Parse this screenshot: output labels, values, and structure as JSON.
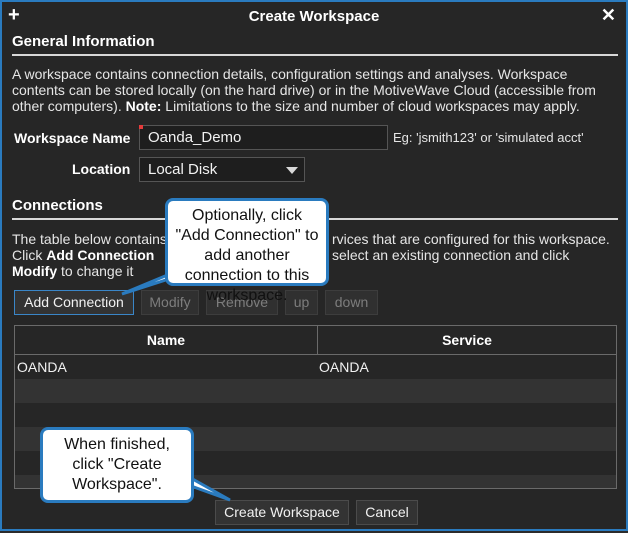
{
  "window": {
    "title": "Create Workspace",
    "add_icon": "+",
    "close_icon": "✕"
  },
  "general": {
    "section_title": "General Information",
    "description_before_note": "A workspace contains connection details, configuration settings and analyses. Workspace contents can be stored locally (on the hard drive) or in the MotiveWave Cloud (accessible from other computers).",
    "note_label": "Note:",
    "description_after_note": " Limitations to the size and number of cloud workspaces may apply."
  },
  "workspace_name": {
    "label": "Workspace Name",
    "value": "Oanda_Demo",
    "hint": "Eg: 'jsmith123' or 'simulated acct'"
  },
  "location": {
    "label": "Location",
    "selected": "Local Disk"
  },
  "connections": {
    "section_title": "Connections",
    "desc_line1_a": "The table below contains",
    "desc_line1_b": "rvices that are configured for this workspace.",
    "desc_line2_a": "Click",
    "desc_line2_bold": "Add Connection",
    "desc_line2_b": "select an existing connection and click",
    "desc_line3_bold": "Modify",
    "desc_line3_a": "to change it",
    "buttons": {
      "add": "Add Connection",
      "modify": "Modify",
      "remove": "Remove",
      "up": "up",
      "down": "down"
    },
    "columns": [
      "Name",
      "Service"
    ],
    "rows": [
      {
        "name": "OANDA",
        "service": "OANDA"
      }
    ]
  },
  "callouts": {
    "add_connection": "Optionally, click \"Add Connection\" to add another connection to this workspace.",
    "finish": "When finished, click \"Create Workspace\"."
  },
  "footer": {
    "create": "Create Workspace",
    "cancel": "Cancel"
  },
  "colors": {
    "accent": "#2a7bbf",
    "background": "#262626",
    "required": "#e53b3b"
  }
}
